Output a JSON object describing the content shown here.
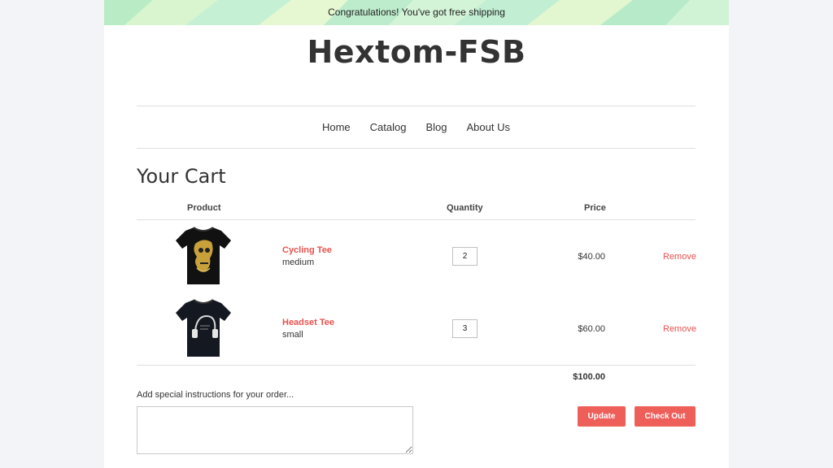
{
  "banner": {
    "text": "Congratulations! You've got free shipping"
  },
  "store": {
    "name": "Hextom-FSB"
  },
  "nav": {
    "items": [
      "Home",
      "Catalog",
      "Blog",
      "About Us"
    ]
  },
  "cart": {
    "title": "Your Cart",
    "headers": {
      "product": "Product",
      "quantity": "Quantity",
      "price": "Price"
    },
    "items": [
      {
        "name": "Cycling Tee",
        "variant": "medium",
        "quantity": "2",
        "price": "$40.00",
        "remove": "Remove",
        "image_icon": "black-tshirt-skull-print-icon"
      },
      {
        "name": "Headset Tee",
        "variant": "small",
        "quantity": "3",
        "price": "$60.00",
        "remove": "Remove",
        "image_icon": "black-tshirt-headphones-print-icon"
      }
    ],
    "total": "$100.00",
    "notes_label": "Add special instructions for your order...",
    "notes_value": "",
    "update_label": "Update",
    "checkout_label": "Check Out"
  },
  "colors": {
    "accent": "#ef5f5a",
    "link": "#e8514e",
    "banner": "#c9f0cf",
    "background": "#f3f4f8"
  }
}
